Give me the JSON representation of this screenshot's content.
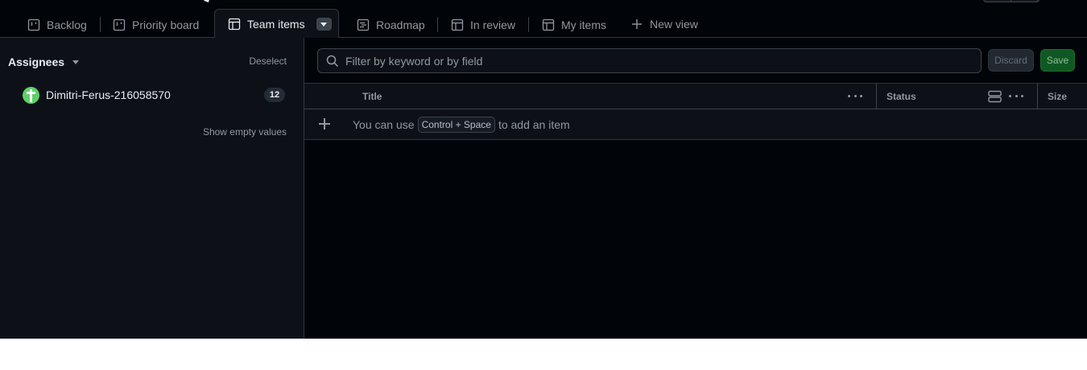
{
  "tabs": [
    {
      "label": "Backlog",
      "icon": "board-icon"
    },
    {
      "label": "Priority board",
      "icon": "board-icon"
    },
    {
      "label": "Team items",
      "icon": "table-icon",
      "active": true
    },
    {
      "label": "Roadmap",
      "icon": "roadmap-icon"
    },
    {
      "label": "In review",
      "icon": "table-icon"
    },
    {
      "label": "My items",
      "icon": "table-icon"
    }
  ],
  "new_view_label": "New view",
  "sidebar": {
    "title": "Assignees",
    "deselect_label": "Deselect",
    "assignees": [
      {
        "name": "Dimitri-Ferus-216058570",
        "count": "12"
      }
    ],
    "show_empty_label": "Show empty values"
  },
  "filter": {
    "placeholder": "Filter by keyword or by field",
    "value": ""
  },
  "actions": {
    "discard_label": "Discard",
    "save_label": "Save"
  },
  "table": {
    "columns": {
      "title": "Title",
      "status": "Status",
      "size": "Size"
    },
    "add_item": {
      "prefix": "You can use",
      "shortcut": "Control + Space",
      "suffix": "to add an item"
    }
  },
  "colors": {
    "background": "#010409",
    "panel": "#0d1117",
    "border": "#30363d",
    "save_green": "#105823",
    "avatar_green": "#5fd068"
  }
}
